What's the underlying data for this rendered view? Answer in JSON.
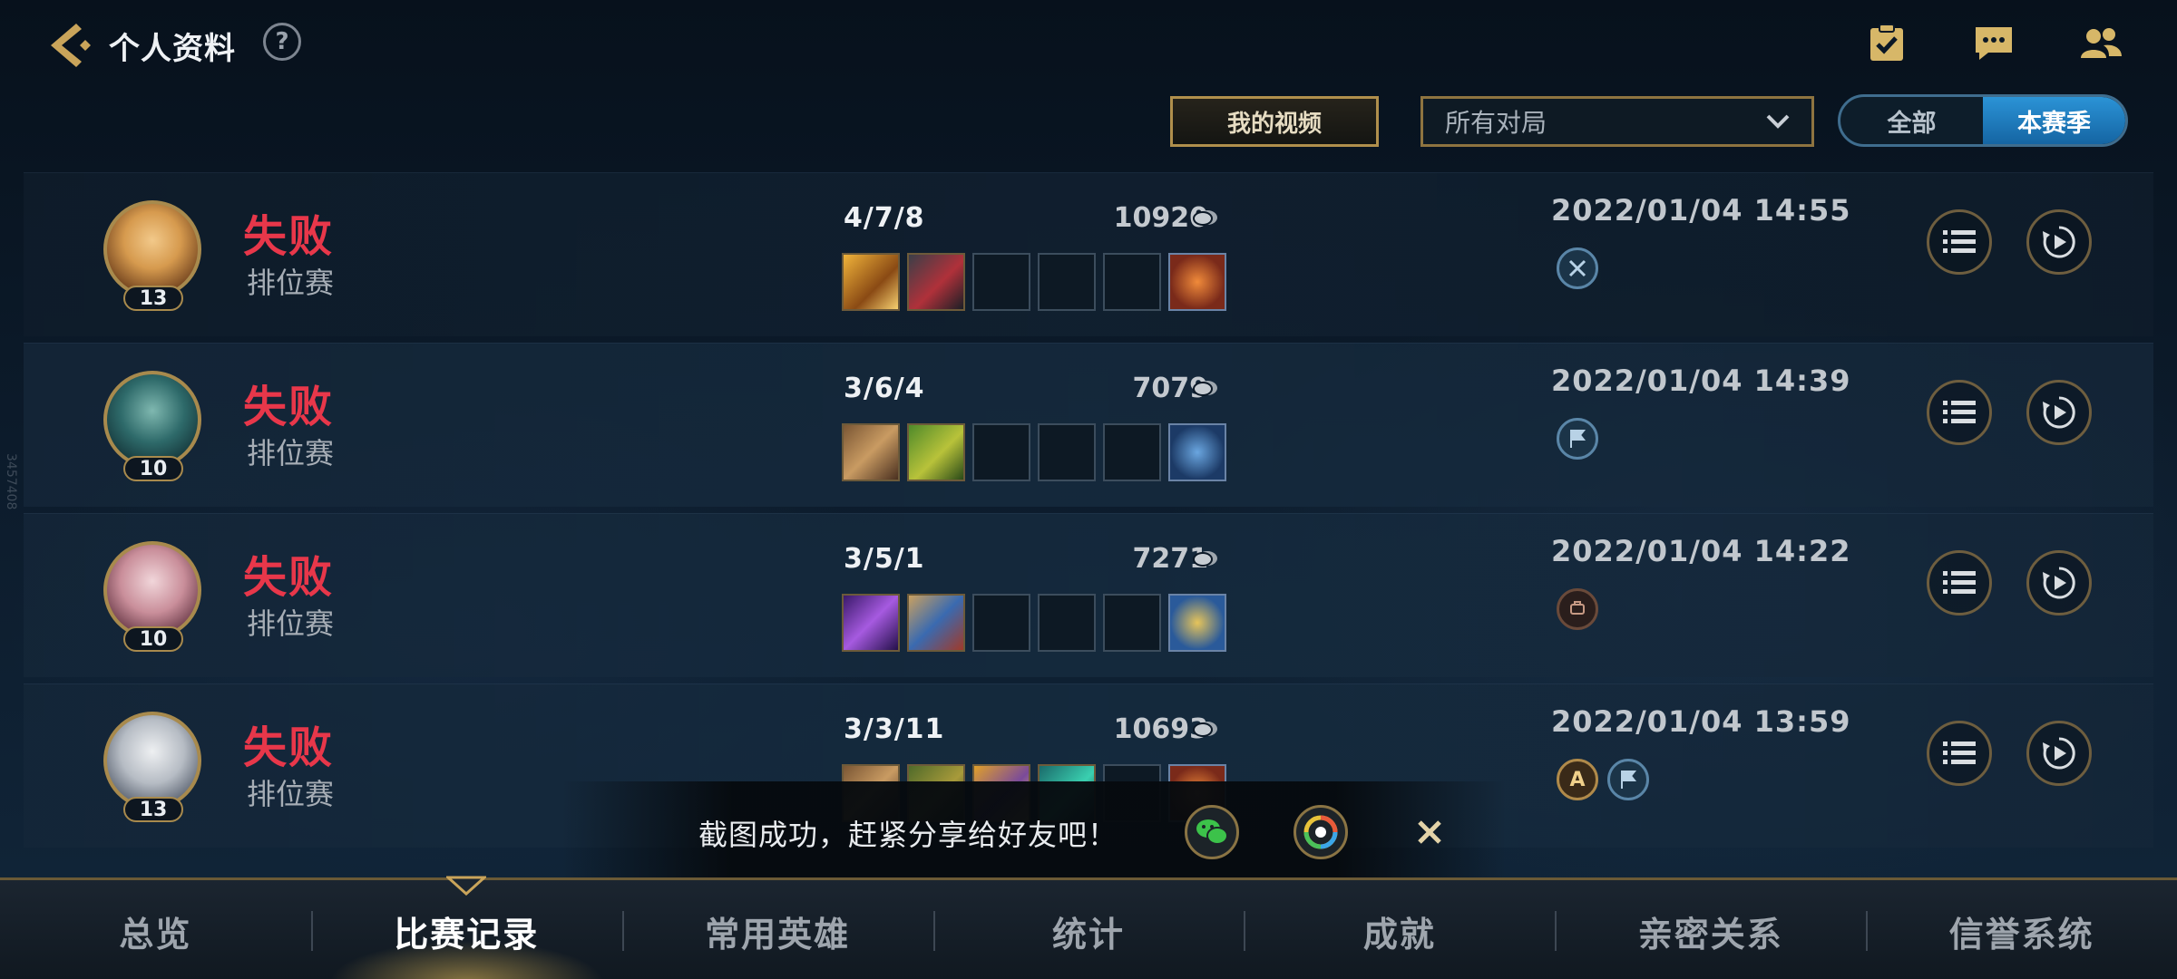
{
  "header": {
    "title": "个人资料",
    "help_label": "?"
  },
  "top_icons": [
    "task-checklist-icon",
    "chat-icon",
    "friends-icon"
  ],
  "filters": {
    "my_videos_label": "我的视频",
    "match_type_value": "所有对局",
    "season_options": [
      "全部",
      "本赛季"
    ],
    "season_selected": "本赛季"
  },
  "side_watermark": "3457408",
  "matches": [
    {
      "champion_level": "13",
      "result": "失败",
      "mode": "排位赛",
      "kda": "4/7/8",
      "gold": "10920",
      "datetime": "2022/01/04 14:55",
      "tags": [
        "swords-badge"
      ]
    },
    {
      "champion_level": "10",
      "result": "失败",
      "mode": "排位赛",
      "kda": "3/6/4",
      "gold": "7079",
      "datetime": "2022/01/04 14:39",
      "tags": [
        "flag-badge"
      ]
    },
    {
      "champion_level": "10",
      "result": "失败",
      "mode": "排位赛",
      "kda": "3/5/1",
      "gold": "7271",
      "datetime": "2022/01/04 14:22",
      "tags": [
        "bronze-badge"
      ]
    },
    {
      "champion_level": "13",
      "result": "失败",
      "mode": "排位赛",
      "kda": "3/3/11",
      "gold": "10693",
      "datetime": "2022/01/04 13:59",
      "tags": [
        "grade-a-badge",
        "flag-badge"
      ],
      "grade_label": "A"
    }
  ],
  "toast": {
    "message": "截图成功，赶紧分享给好友吧！"
  },
  "bottom_nav": {
    "tabs": [
      "总览",
      "比赛记录",
      "常用英雄",
      "统计",
      "成就",
      "亲密关系",
      "信誉系统"
    ],
    "active": "比赛记录"
  },
  "colors": {
    "loss_red": "#e8374a",
    "gold_border": "#a88a4d",
    "active_blue": "#1f7fc2"
  }
}
